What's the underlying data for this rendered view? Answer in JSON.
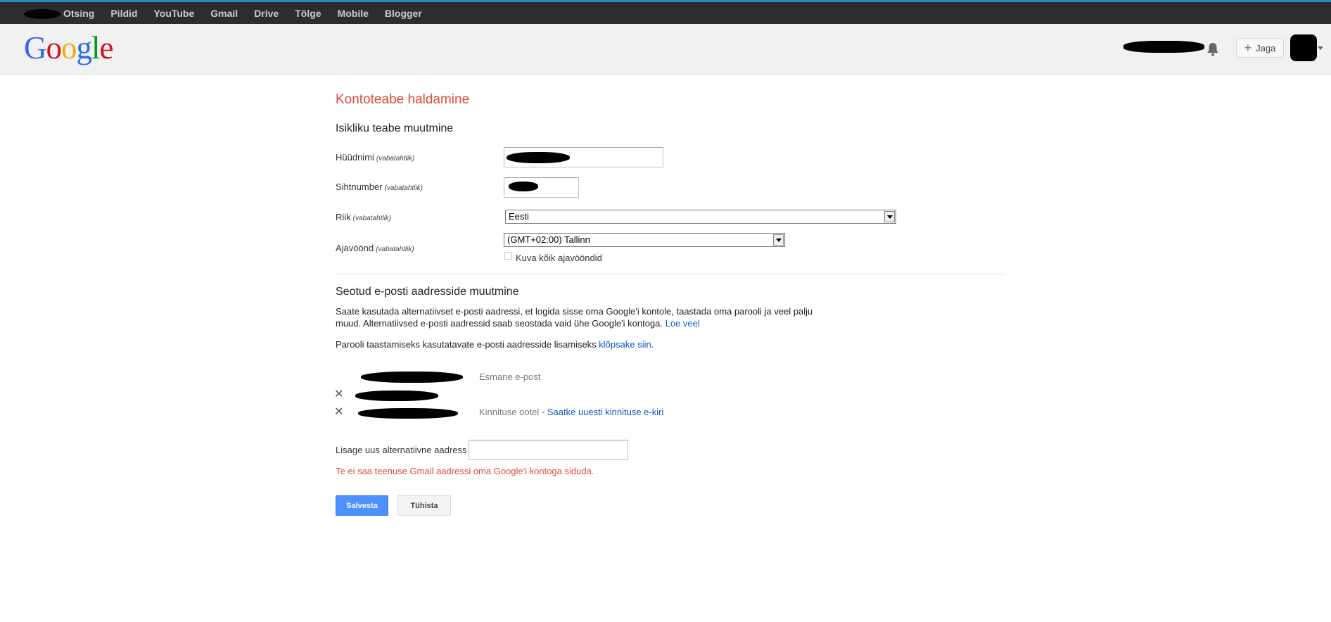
{
  "topnav": {
    "items": [
      {
        "label": "Otsing"
      },
      {
        "label": "Pildid"
      },
      {
        "label": "YouTube"
      },
      {
        "label": "Gmail"
      },
      {
        "label": "Drive"
      },
      {
        "label": "Tõlge"
      },
      {
        "label": "Mobile"
      },
      {
        "label": "Blogger"
      }
    ]
  },
  "header": {
    "logo": "Google",
    "share_label": "Jaga",
    "bell_icon": "bell-icon",
    "colors": {
      "accent_bar": "#1e8fc6",
      "topbar_bg": "#2d2d2d"
    }
  },
  "page": {
    "title": "Kontoteabe haldamine",
    "title_color": "#dd4b39"
  },
  "personal": {
    "heading": "Isikliku teabe muutmine",
    "optional": "(vabatahtlik)",
    "nickname_label": "Hüüdnimi",
    "postal_label": "Sihtnumber",
    "country_label": "Riik",
    "country_value": "Eesti",
    "timezone_label": "Ajavöönd",
    "timezone_value": "(GMT+02:00) Tallinn",
    "show_all_timezones": "Kuva kõik ajavööndid"
  },
  "email": {
    "heading": "Seotud e-posti aadresside muutmine",
    "desc_line1": "Saate kasutada alternatiivset e-posti aadressi, et logida sisse oma Google'i kontole, taastada oma parooli ja veel palju",
    "desc_line2": "muud. Alternatiivsed e-posti aadressid saab seostada vaid ühe Google'i kontoga.",
    "learn_more": "Loe veel",
    "recovery_text": "Parooli taastamiseks kasutatavate e-posti aadresside lisamiseks",
    "recovery_link": "klõpsake siin",
    "primary_status": "Esmane e-post",
    "pending_status": "Kinnituse ootel -",
    "resend_link": "Saatke uuesti kinnituse e-kiri",
    "add_label": "Lisage uus alternatiivne aadress",
    "error_text": "Te ei saa teenuse Gmail aadressi oma Google'i kontoga siduda."
  },
  "actions": {
    "save_label": "Salvesta",
    "cancel_label": "Tühista"
  }
}
